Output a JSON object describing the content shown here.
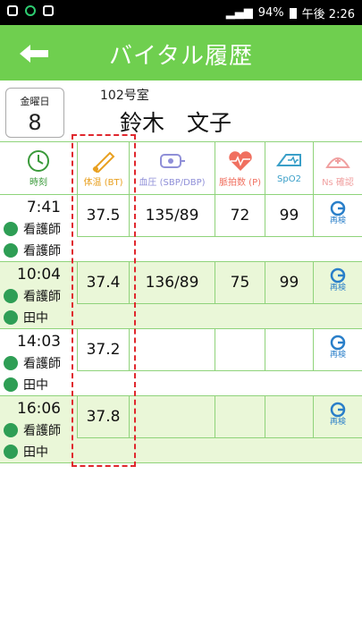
{
  "status_bar": {
    "battery": "94%",
    "time": "午後 2:26"
  },
  "header": {
    "title": "バイタル履歴",
    "back_icon": "arrow-left-icon",
    "color": "#6fcf4f"
  },
  "date": {
    "weekday": "金曜日",
    "day": "8"
  },
  "patient": {
    "room": "102号室",
    "name": "鈴木　文子"
  },
  "columns": [
    {
      "label": "時刻",
      "icon": "clock-icon",
      "color": "#3a9a3a"
    },
    {
      "label": "体温 (BT)",
      "icon": "thermometer-icon",
      "color": "#e8a020"
    },
    {
      "label": "血圧 (SBP/DBP)",
      "icon": "blood-pressure-icon",
      "color": "#8f8fd8"
    },
    {
      "label": "脈拍数 (P)",
      "icon": "heart-pulse-icon",
      "color": "#f07060"
    },
    {
      "label": "SpO2",
      "icon": "pulse-oximeter-icon",
      "color": "#3a9fc8"
    },
    {
      "label": "Ns 確認",
      "icon": "nurse-cap-icon",
      "color": "#f0a0a0"
    }
  ],
  "records": [
    {
      "time": "7:41",
      "staff1": "看護師",
      "staff2": "看護師",
      "bt": "37.5",
      "bp": "135/89",
      "pulse": "72",
      "spo2": "99",
      "recheck": "再検"
    },
    {
      "time": "10:04",
      "staff1": "看護師",
      "staff2": "田中",
      "bt": "37.4",
      "bp": "136/89",
      "pulse": "75",
      "spo2": "99",
      "recheck": "再検"
    },
    {
      "time": "14:03",
      "staff1": "看護師",
      "staff2": "田中",
      "bt": "37.2",
      "bp": "",
      "pulse": "",
      "spo2": "",
      "recheck": "再検"
    },
    {
      "time": "16:06",
      "staff1": "看護師",
      "staff2": "田中",
      "bt": "37.8",
      "bp": "",
      "pulse": "",
      "spo2": "",
      "recheck": "再検"
    }
  ]
}
